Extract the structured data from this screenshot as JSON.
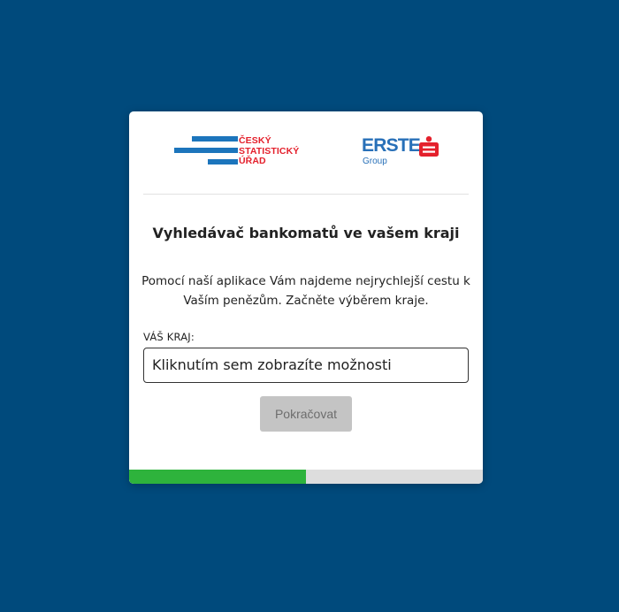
{
  "logos": {
    "czso_lines": [
      "ČESKÝ",
      "STATISTICKÝ",
      "ÚŘAD"
    ],
    "czso_color_blue": "#1c75bc",
    "czso_color_red": "#e4202c",
    "erste_name": "ERSTE",
    "erste_sub": "Group",
    "erste_color": "#2870b8",
    "erste_emblem_color": "#e4202c"
  },
  "title": "Vyhledávač bankomatů ve vašem kraji",
  "description": "Pomocí naší aplikace Vám najdeme nejrychlejší cestu k Vaším penězům. Začněte výběrem kraje.",
  "region_field": {
    "label": "VÁŠ KRAJ:",
    "placeholder": "Kliknutím sem zobrazíte možnosti"
  },
  "continue_button": "Pokračovat",
  "progress": {
    "fraction": 0.5,
    "fill_color": "#2eb33c",
    "track_color": "#dddddd"
  },
  "page_background": "#004a7c"
}
